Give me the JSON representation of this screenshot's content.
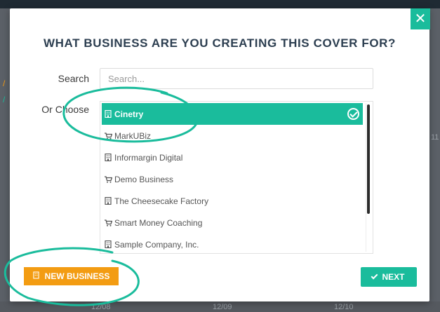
{
  "background": {
    "axis_ticks": [
      "12/08",
      "12/09",
      "12/10"
    ],
    "edge_tick": "11"
  },
  "modal": {
    "title": "WHAT BUSINESS ARE YOU CREATING THIS COVER FOR?",
    "close_icon": "close-icon",
    "search": {
      "label": "Search",
      "placeholder": "Search...",
      "value": ""
    },
    "choose": {
      "label": "Or Choose",
      "selected_index": 0,
      "items": [
        {
          "label": "Cinetry",
          "icon": "building-icon",
          "selected": true
        },
        {
          "label": "MarkUBiz",
          "icon": "cart-icon",
          "selected": false
        },
        {
          "label": "Informargin Digital",
          "icon": "building-icon",
          "selected": false
        },
        {
          "label": "Demo Business",
          "icon": "cart-icon",
          "selected": false
        },
        {
          "label": "The Cheesecake Factory",
          "icon": "building-icon",
          "selected": false
        },
        {
          "label": "Smart Money Coaching",
          "icon": "cart-icon",
          "selected": false
        },
        {
          "label": "Sample Company, Inc.",
          "icon": "building-icon",
          "selected": false
        }
      ]
    },
    "buttons": {
      "new_business": "NEW BUSINESS",
      "next": "NEXT"
    }
  },
  "colors": {
    "accent": "#1abc9c",
    "orange": "#f39c12",
    "title": "#2c3e50",
    "annotation": "#1abc9c"
  }
}
